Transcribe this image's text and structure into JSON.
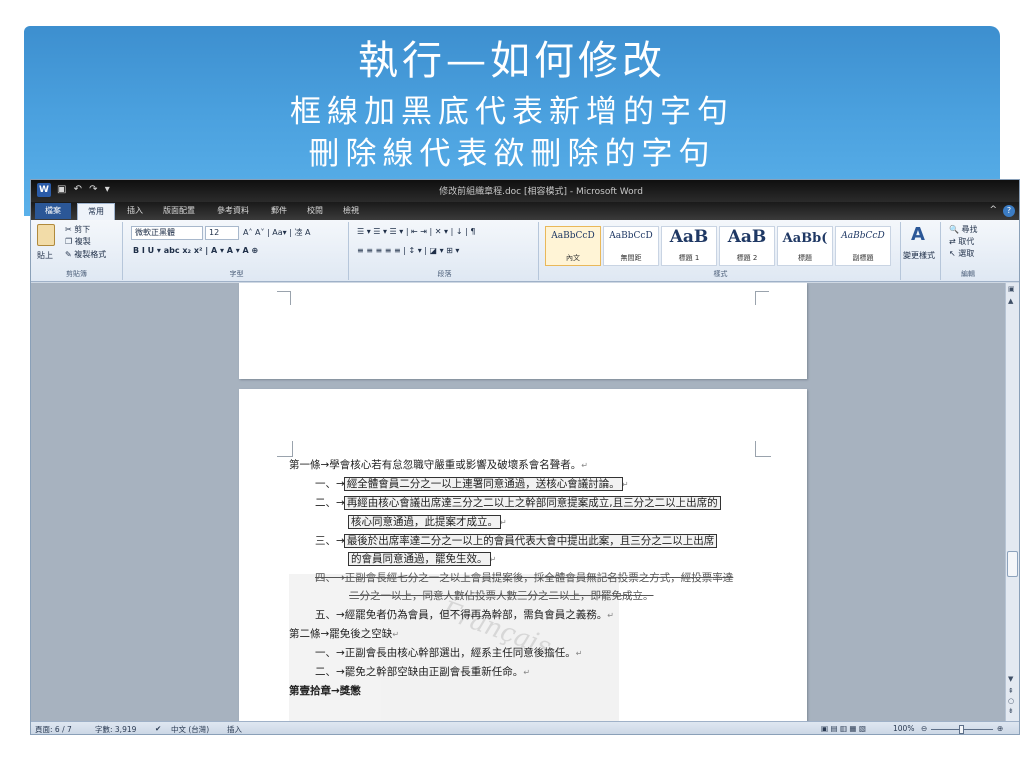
{
  "slide": {
    "title": "執行—如何修改",
    "subtitle1": "框線加黑底代表新增的字句",
    "subtitle2": "刪除線代表欲刪除的字句"
  },
  "word": {
    "window_title": "修改前組織章程.doc [相容模式] - Microsoft Word",
    "app_letter": "W",
    "tabs": [
      "檔案",
      "常用",
      "插入",
      "版面配置",
      "參考資料",
      "郵件",
      "校閱",
      "檢視"
    ],
    "ribbon": {
      "clipboard": {
        "paste": "貼上",
        "cut": "剪下",
        "copy": "複製",
        "format_painter": "複製格式",
        "label": "剪貼簿"
      },
      "font": {
        "name": "微軟正黑體",
        "size": "12",
        "label": "字型"
      },
      "paragraph": {
        "label": "段落"
      },
      "styles": {
        "items": [
          {
            "preview": "AaBbCcD",
            "name": "內文"
          },
          {
            "preview": "AaBbCcD",
            "name": "無間距"
          },
          {
            "preview": "AaB",
            "name": "標題 1"
          },
          {
            "preview": "AaB",
            "name": "標題 2"
          },
          {
            "preview": "AaBb(",
            "name": "標題"
          },
          {
            "preview": "AaBbCcD",
            "name": "副標題"
          }
        ],
        "change_styles": "變更樣式",
        "label": "樣式"
      },
      "editing": {
        "find": "尋找",
        "replace": "取代",
        "select": "選取",
        "label": "編輯"
      }
    },
    "document": {
      "lines": [
        "第一條→學會核心若有怠忽職守嚴重或影響及破壞系會名聲者。",
        "一、→",
        "經全體會員二分之一以上連署同意通過，送核心會議討論。",
        "二、→",
        "再經由核心會議出席達三分之二以上之幹部同意提案成立,且三分之二以上出席的",
        "核心同意通過，此提案才成立。",
        "三、→",
        "最後於出席率達二分之一以上的會員代表大會中提出此案，且三分之二以上出席",
        "的會員同意通過，罷免生效。",
        "四、→正副會長經七分之一之以上會員提案後，採全體會員無記名投票之方式，經投票率達",
        "二分之一以上，同意人數佔投票人數三分之二以上，即罷免成立。",
        "五、→經罷免者仍為會員，但不得再為幹部，需負會員之義務。",
        "第二條→罷免後之空缺",
        "一、→正副會長由核心幹部選出，經系主任同意後擔任。",
        "二、→罷免之幹部空缺由正副會長重新任命。",
        "第壹拾章→獎懲"
      ],
      "watermark": "Français"
    },
    "status": {
      "page": "頁面: 6 / 7",
      "words": "字數: 3,919",
      "language": "中文 (台灣)",
      "mode": "插入",
      "zoom": "100%"
    }
  }
}
